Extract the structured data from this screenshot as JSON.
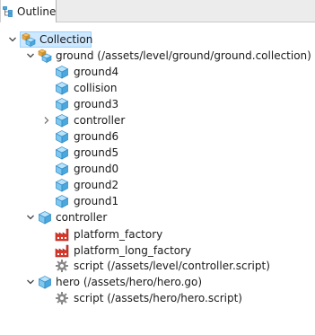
{
  "tab": {
    "label": "Outline",
    "icon": "outline-icon"
  },
  "colors": {
    "cube_top": "#b8e3fa",
    "cube_left": "#7ec8f0",
    "cube_right": "#4aa8de",
    "cube_edge": "#2d86c2",
    "factory": "#d9382b",
    "gear": "#8a8a8a",
    "selection_bg": "#cde8ff",
    "selection_border": "#99d1ff"
  },
  "tree": [
    {
      "key": "collection",
      "label": "Collection",
      "icon": "collection-icon",
      "toggle": "expanded",
      "selected": true
    },
    {
      "key": "ground",
      "label": "ground (/assets/level/ground/ground.collection)",
      "icon": "collection-icon",
      "toggle": "expanded"
    },
    {
      "key": "ground4",
      "label": "ground4",
      "icon": "game-object-icon",
      "toggle": "none"
    },
    {
      "key": "collision",
      "label": "collision",
      "icon": "game-object-icon",
      "toggle": "none"
    },
    {
      "key": "ground3",
      "label": "ground3",
      "icon": "game-object-icon",
      "toggle": "none"
    },
    {
      "key": "controller-go",
      "label": "controller",
      "icon": "game-object-icon",
      "toggle": "collapsed"
    },
    {
      "key": "ground6",
      "label": "ground6",
      "icon": "game-object-icon",
      "toggle": "none"
    },
    {
      "key": "ground5",
      "label": "ground5",
      "icon": "game-object-icon",
      "toggle": "none"
    },
    {
      "key": "ground0",
      "label": "ground0",
      "icon": "game-object-icon",
      "toggle": "none"
    },
    {
      "key": "ground2",
      "label": "ground2",
      "icon": "game-object-icon",
      "toggle": "none"
    },
    {
      "key": "ground1",
      "label": "ground1",
      "icon": "game-object-icon",
      "toggle": "none"
    },
    {
      "key": "controller",
      "label": "controller",
      "icon": "game-object-icon",
      "toggle": "expanded"
    },
    {
      "key": "platform-factory",
      "label": "platform_factory",
      "icon": "factory-icon",
      "toggle": "none"
    },
    {
      "key": "platform-long-factory",
      "label": "platform_long_factory",
      "icon": "factory-icon",
      "toggle": "none"
    },
    {
      "key": "controller-script",
      "label": "script (/assets/level/controller.script)",
      "icon": "script-gear-icon",
      "toggle": "none"
    },
    {
      "key": "hero",
      "label": "hero (/assets/hero/hero.go)",
      "icon": "game-object-icon",
      "toggle": "expanded"
    },
    {
      "key": "hero-script",
      "label": "script (/assets/hero/hero.script)",
      "icon": "script-gear-icon",
      "toggle": "none"
    }
  ]
}
